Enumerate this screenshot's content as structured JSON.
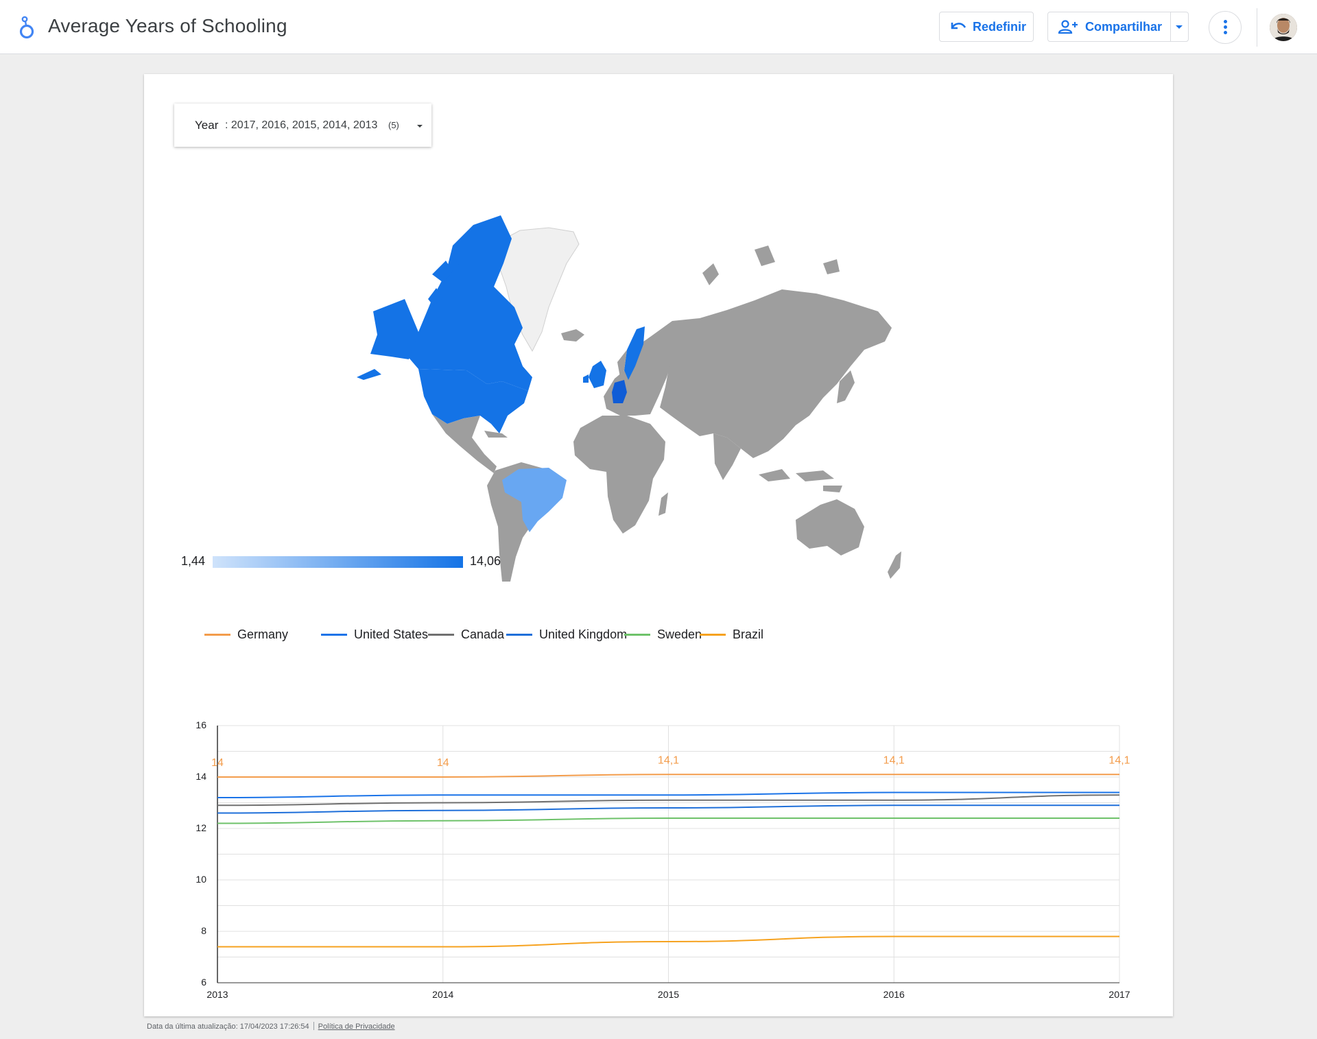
{
  "header": {
    "title": "Average Years of Schooling",
    "reset_label": "Redefinir",
    "share_label": "Compartilhar"
  },
  "filter": {
    "label": "Year",
    "values": ": 2017, 2016, 2015, 2014, 2013",
    "count": "(5)"
  },
  "map": {
    "scale_min": "1,44",
    "scale_max": "14,06",
    "colors": {
      "high": "#1473e6",
      "medium": "#68a7f2",
      "no_data": "#9e9e9e",
      "unselected": "#f0f0f0"
    }
  },
  "chart_data": {
    "type": "line",
    "x": [
      2013,
      2014,
      2015,
      2016,
      2017
    ],
    "ylim": [
      6,
      16
    ],
    "yticks": [
      6,
      8,
      10,
      12,
      14,
      16
    ],
    "grid": true,
    "legend_position": "top-left",
    "series": [
      {
        "name": "Germany",
        "color": "#f39c4b",
        "values": [
          14.0,
          14.0,
          14.1,
          14.1,
          14.1
        ],
        "labels": [
          "14",
          "14",
          "14,1",
          "14,1",
          "14,1"
        ]
      },
      {
        "name": "United States",
        "color": "#1a73e8",
        "values": [
          13.2,
          13.3,
          13.3,
          13.4,
          13.4
        ]
      },
      {
        "name": "Canada",
        "color": "#707070",
        "values": [
          12.9,
          13.0,
          13.1,
          13.1,
          13.3
        ]
      },
      {
        "name": "United Kingdom",
        "color": "#1e6fd9",
        "values": [
          12.6,
          12.7,
          12.8,
          12.9,
          12.9
        ]
      },
      {
        "name": "Sweden",
        "color": "#6ec26a",
        "values": [
          12.2,
          12.3,
          12.4,
          12.4,
          12.4
        ]
      },
      {
        "name": "Brazil",
        "color": "#f6a21f",
        "values": [
          7.4,
          7.4,
          7.6,
          7.8,
          7.8
        ]
      }
    ]
  },
  "footer": {
    "updated": "Data da última atualização: 17/04/2023 17:26:54",
    "privacy": "Política de Privacidade"
  }
}
